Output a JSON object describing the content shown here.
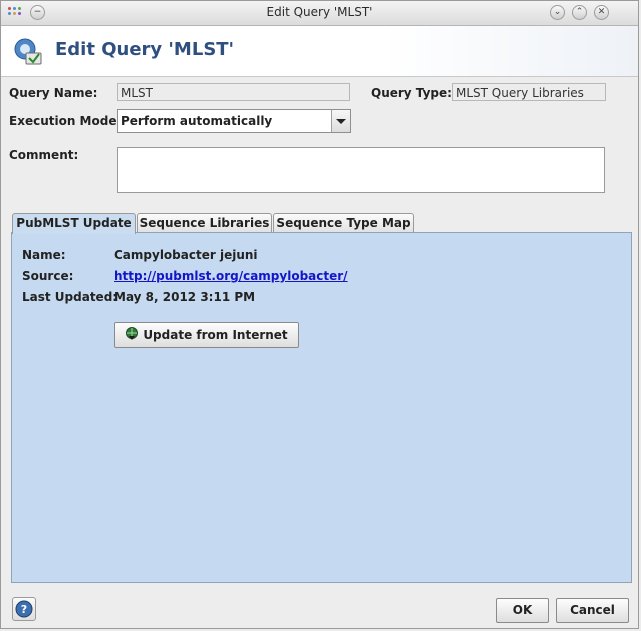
{
  "window": {
    "title": "Edit Query 'MLST'"
  },
  "header": {
    "heading": "Edit Query 'MLST'"
  },
  "form": {
    "query_name_label": "Query Name:",
    "query_name_value": "MLST",
    "query_type_label": "Query Type:",
    "query_type_value": "MLST Query Libraries",
    "execution_mode_label": "Execution Mode:",
    "execution_mode_value": "Perform automatically",
    "comment_label": "Comment:",
    "comment_value": ""
  },
  "tabs": [
    {
      "label": "PubMLST Update",
      "active": true
    },
    {
      "label": "Sequence Libraries",
      "active": false
    },
    {
      "label": "Sequence Type Map",
      "active": false
    }
  ],
  "pubmlst": {
    "name_label": "Name:",
    "name_value": "Campylobacter jejuni",
    "source_label": "Source:",
    "source_value": "http://pubmlst.org/campylobacter/",
    "last_updated_label": "Last Updated:",
    "last_updated_value": "May 8, 2012 3:11 PM",
    "update_button_label": "Update from Internet"
  },
  "footer": {
    "ok_label": "OK",
    "cancel_label": "Cancel"
  },
  "colors": {
    "accent": "#2f4f7f",
    "panel": "#c5daf0",
    "link": "#1515c8"
  },
  "icons": [
    "app-menu-icon",
    "minimize-icon",
    "maximize-icon",
    "close-icon",
    "query-edit-icon",
    "globe-download-icon",
    "help-icon"
  ]
}
